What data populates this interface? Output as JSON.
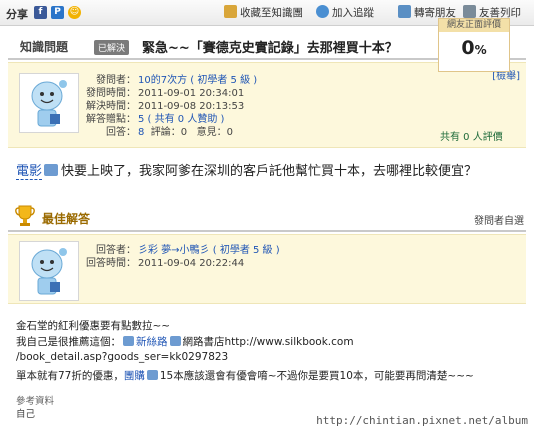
{
  "toolbar": {
    "share_label": "分享",
    "social": [
      "f",
      "P",
      "☺"
    ],
    "favorite_label": "收藏至知識團",
    "follow_label": "加入追蹤",
    "forward_label": "轉寄朋友",
    "print_label": "友善列印"
  },
  "question": {
    "section_label": "知識問題",
    "solved_badge": "已解決",
    "title": "緊急~~「賽德克史實記錄」去那裡買十本？",
    "report_label": "[檢舉]",
    "info": {
      "asker_key": "發問者：",
      "asker_value": "10的7次方 ( 初學者 5 級 )",
      "asked_key": "發問時間：",
      "asked_value": "2011-09-01 20:34:01",
      "solved_key": "解決時間：",
      "solved_value": "2011-09-08 20:13:53",
      "answers_key": "解答贈點：",
      "answers_value": "5 ( 共有 0 人贊助 )",
      "stats_key": "回答：",
      "stats_answers": "8",
      "stats_comments_key": "評論：",
      "stats_comments": "0",
      "stats_opinions_key": "意見：",
      "stats_opinions": "0"
    },
    "rating": {
      "title": "網友正面評價",
      "value": "0",
      "unit": "%",
      "count_text": "共有 0 人評價"
    },
    "body_tag": "電影",
    "body_text": "快要上映了，我家阿爹在深圳的客戶託他幫忙買十本，去哪裡比較便宜？"
  },
  "best_answer": {
    "label": "最佳解答",
    "chosen_by": "發問者自選",
    "info": {
      "answerer_key": "回答者：",
      "answerer_value": "彡彩 夢→小鴨彡 ( 初學者 5 級 )",
      "answered_key": "回答時間：",
      "answered_value": "2011-09-04 20:22:44"
    },
    "lines": {
      "l1": "金石堂的紅利優惠要有點數拉~~",
      "l2a": "我自己是很推薦這個：",
      "l2b": "新絲路",
      "l2c": "網路書店http://www.silkbook.com",
      "l3": "/book_detail.asp?goods_ser=kk0297823",
      "l4a": "單本就有77折的優惠，",
      "l4b": "團購",
      "l4c": "15本應該還會有優會唷~不過你是要買10本，可能要再問清楚~~~"
    },
    "reference_label": "參考資料",
    "reference_value": "自己"
  },
  "watermark": "http://chintian.pixnet.net/album"
}
